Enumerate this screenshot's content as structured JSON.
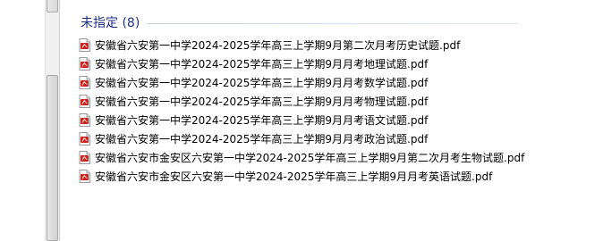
{
  "group": {
    "title": "未指定 (8)"
  },
  "files": [
    {
      "name": "安徽省六安第一中学2024-2025学年高三上学期9月第二次月考历史试题.pdf",
      "icon": "pdf-file-icon"
    },
    {
      "name": "安徽省六安第一中学2024-2025学年高三上学期9月月考地理试题.pdf",
      "icon": "pdf-file-icon"
    },
    {
      "name": "安徽省六安第一中学2024-2025学年高三上学期9月月考数学试题.pdf",
      "icon": "pdf-file-icon"
    },
    {
      "name": "安徽省六安第一中学2024-2025学年高三上学期9月月考物理试题.pdf",
      "icon": "pdf-file-icon"
    },
    {
      "name": "安徽省六安第一中学2024-2025学年高三上学期9月月考语文试题.pdf",
      "icon": "pdf-file-icon"
    },
    {
      "name": "安徽省六安第一中学2024-2025学年高三上学期9月月考政治试题.pdf",
      "icon": "pdf-file-icon"
    },
    {
      "name": "安徽省六安市金安区六安第一中学2024-2025学年高三上学期9月第二次月考生物试题.pdf",
      "icon": "pdf-file-icon"
    },
    {
      "name": "安徽省六安市金安区六安第一中学2024-2025学年高三上学期9月月考英语试题.pdf",
      "icon": "pdf-file-icon"
    }
  ],
  "colors": {
    "group_title": "#1e3287",
    "pdf_icon_red": "#d0201b"
  }
}
